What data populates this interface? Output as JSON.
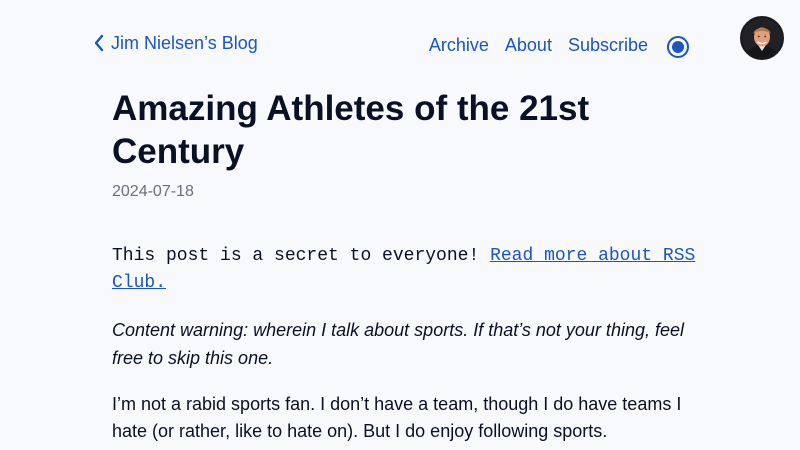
{
  "header": {
    "back_label": "Jim Nielsen’s Blog",
    "nav": [
      {
        "label": "Archive"
      },
      {
        "label": "About"
      },
      {
        "label": "Subscribe"
      }
    ]
  },
  "post": {
    "title": "Amazing Athletes of the 21st Century",
    "date": "2024-07-18",
    "secret_text": "This post is a secret to everyone! ",
    "secret_link": "Read more about RSS Club.",
    "content_warning": "Content warning: wherein I talk about sports. If that’s not your thing, feel free to skip this one.",
    "intro": "I’m not a rabid sports fan. I don’t have a team, though I do have teams I hate (or rather, like to hate on). But I do enjoy following sports."
  },
  "colors": {
    "link": "#1a55c0",
    "text": "#0a1124",
    "background": "#f8f9fc",
    "muted": "#6b6f7b"
  },
  "icons": {
    "back": "chevron-left-icon",
    "theme": "theme-toggle-icon",
    "avatar": "avatar-photo"
  }
}
